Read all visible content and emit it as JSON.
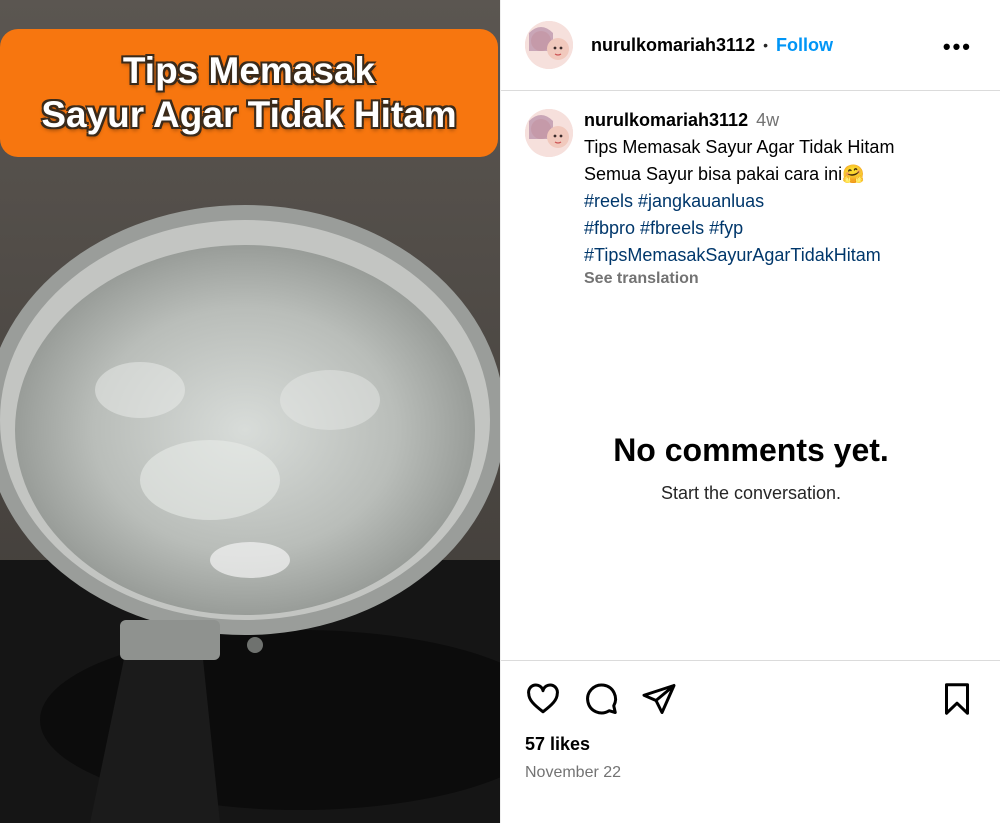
{
  "post": {
    "overlay_title_line1": "Tips Memasak",
    "overlay_title_line2": "Sayur Agar Tidak Hitam",
    "username": "nurulkomariah3112",
    "separator": "•",
    "follow_label": "Follow",
    "more_label": "•••",
    "time_ago": "4w",
    "caption_line1": "Tips Memasak Sayur Agar Tidak Hitam",
    "caption_line2": "Semua Sayur bisa pakai cara ini🤗",
    "hashtags_line1": "#reels #jangkauanluas",
    "hashtags_line2": "#fbpro #fbreels #fyp",
    "hashtags_line3": "#TipsMemasakSayurAgarTidakHitam",
    "see_translation": "See translation",
    "no_comments_title": "No comments yet.",
    "no_comments_sub": "Start the conversation.",
    "likes": "57 likes",
    "date": "November 22"
  },
  "colors": {
    "overlay_bg": "#f7760f",
    "follow_blue": "#0095f6",
    "hashtag_blue": "#00376b",
    "muted_gray": "#737373"
  },
  "icons": [
    "like-heart-icon",
    "comment-icon",
    "share-icon",
    "save-bookmark-icon",
    "more-options-icon"
  ]
}
